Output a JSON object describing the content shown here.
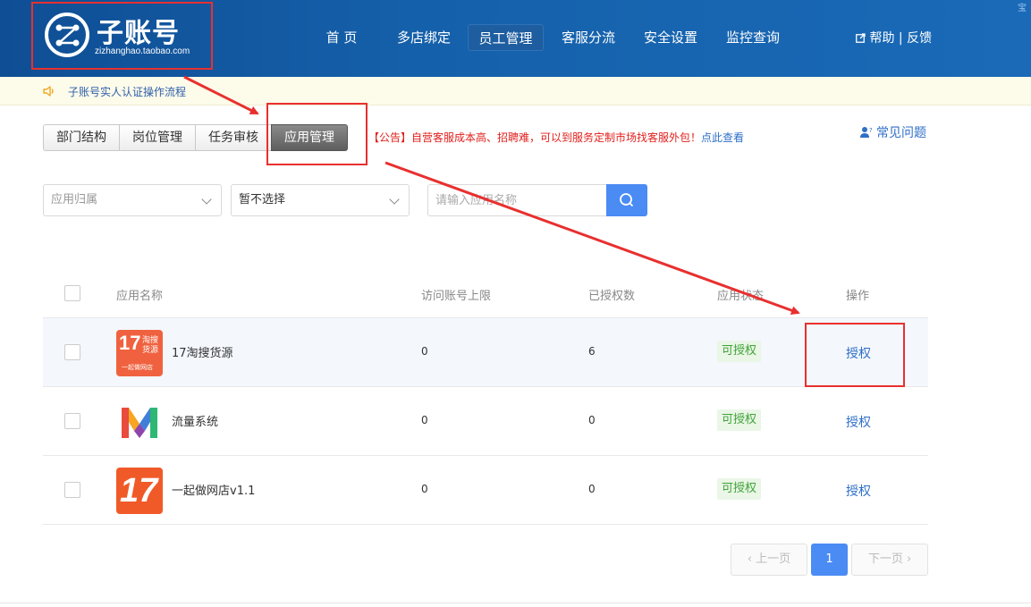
{
  "header": {
    "logo_title": "子账号",
    "logo_subtitle": "zizhanghao.taobao.com",
    "nav": [
      {
        "label": "首 页"
      },
      {
        "label": "多店绑定"
      },
      {
        "label": "员工管理",
        "active": true
      },
      {
        "label": "客服分流"
      },
      {
        "label": "安全设置"
      },
      {
        "label": "监控查询"
      }
    ],
    "help": "帮助",
    "separator": "|",
    "feedback": "反馈",
    "corner_mark": "宝"
  },
  "notice": {
    "text": "子账号实人认证操作流程"
  },
  "tabs": [
    {
      "label": "部门结构"
    },
    {
      "label": "岗位管理"
    },
    {
      "label": "任务审核"
    },
    {
      "label": "应用管理",
      "active": true
    }
  ],
  "announcement": {
    "text": "【公告】自营客服成本高、招聘难，可以到服务定制市场找客服外包！",
    "link": "点此查看"
  },
  "faq": "常见问题",
  "filters": {
    "app_owner_placeholder": "应用归属",
    "second_select_value": "暂不选择",
    "search_placeholder": "请输入应用名称"
  },
  "table": {
    "headers": {
      "name": "应用名称",
      "limit": "访问账号上限",
      "authorized": "已授权数",
      "status": "应用状态",
      "action": "操作"
    },
    "rows": [
      {
        "name": "17淘搜货源",
        "limit": "0",
        "authorized": "6",
        "status": "可授权",
        "action": "授权",
        "icon_line1": "17",
        "icon_line2": "淘搜",
        "icon_line3": "货源",
        "icon_line4": "一起做网店"
      },
      {
        "name": "流量系统",
        "limit": "0",
        "authorized": "0",
        "status": "可授权",
        "action": "授权"
      },
      {
        "name": "一起做网店v1.1",
        "limit": "0",
        "authorized": "0",
        "status": "可授权",
        "action": "授权",
        "icon_line1": "17"
      }
    ]
  },
  "pagination": {
    "prev": "‹ 上一页",
    "current": "1",
    "next": "下一页 ›"
  },
  "colors": {
    "header_blue": "#1560aa",
    "accent_blue": "#4b8bf4",
    "annotation_red": "#e8302f",
    "status_green": "#3fa33a"
  }
}
